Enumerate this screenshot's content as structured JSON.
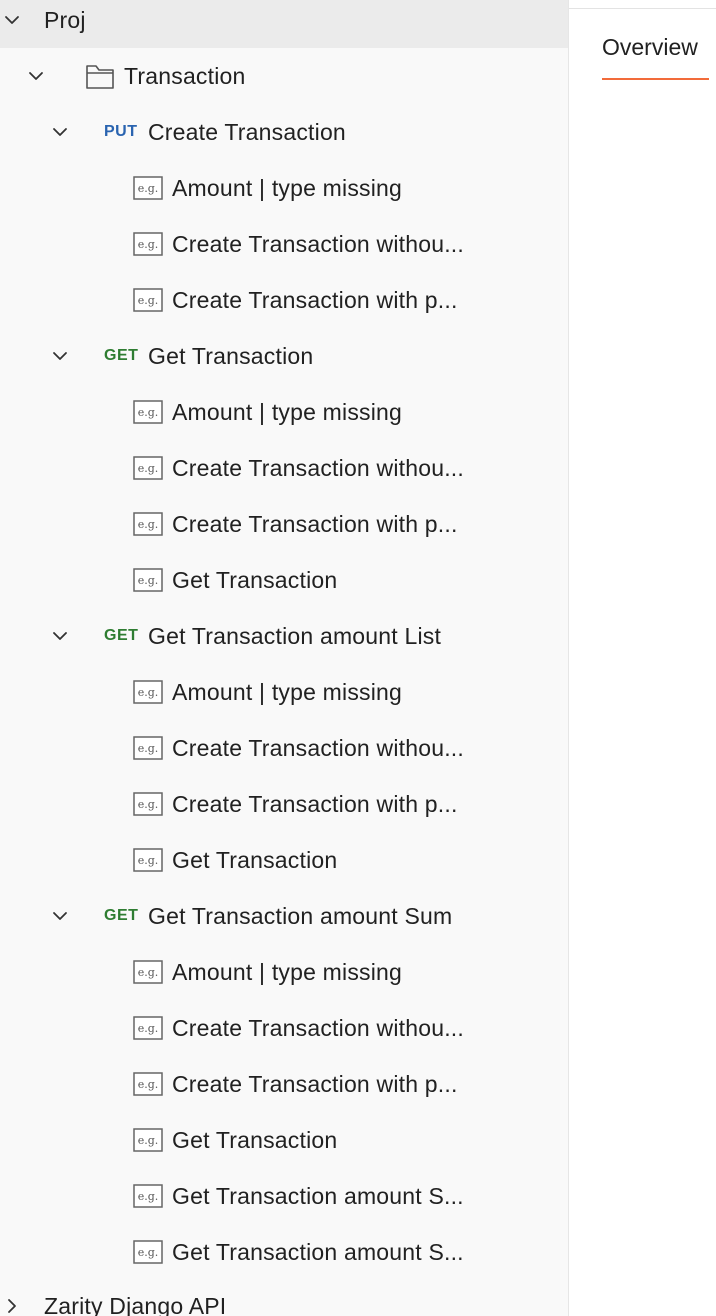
{
  "sidebar": {
    "root": {
      "label": "Proj"
    },
    "folder": {
      "label": "Transaction"
    },
    "requests": [
      {
        "method": "PUT",
        "label": "Create Transaction",
        "examples": [
          "Amount | type missing",
          "Create Transaction withou...",
          "Create Transaction with p..."
        ]
      },
      {
        "method": "GET",
        "label": "Get Transaction",
        "examples": [
          "Amount | type missing",
          "Create Transaction withou...",
          "Create Transaction with p...",
          "Get Transaction"
        ]
      },
      {
        "method": "GET",
        "label": "Get Transaction amount List",
        "examples": [
          "Amount | type missing",
          "Create Transaction withou...",
          "Create Transaction with p...",
          "Get Transaction"
        ]
      },
      {
        "method": "GET",
        "label": "Get Transaction amount Sum",
        "examples": [
          "Amount | type missing",
          "Create Transaction withou...",
          "Create Transaction with p...",
          "Get Transaction",
          "Get Transaction amount S...",
          "Get Transaction amount S..."
        ]
      }
    ],
    "next_collection": {
      "label": "Zarity Django API"
    },
    "icons": {
      "expanded": "chevron-down-icon",
      "collapsed": "chevron-right-icon",
      "folder": "folder-icon",
      "example": "example-icon"
    },
    "colors": {
      "put": "#2a64b0",
      "get": "#2f7d32",
      "selected_bg": "#ebebeb",
      "sidebar_bg": "#f9f9f9"
    }
  },
  "main": {
    "tabs": [
      {
        "label": "Overview",
        "active": true
      }
    ],
    "accent": "#f26b3a"
  }
}
